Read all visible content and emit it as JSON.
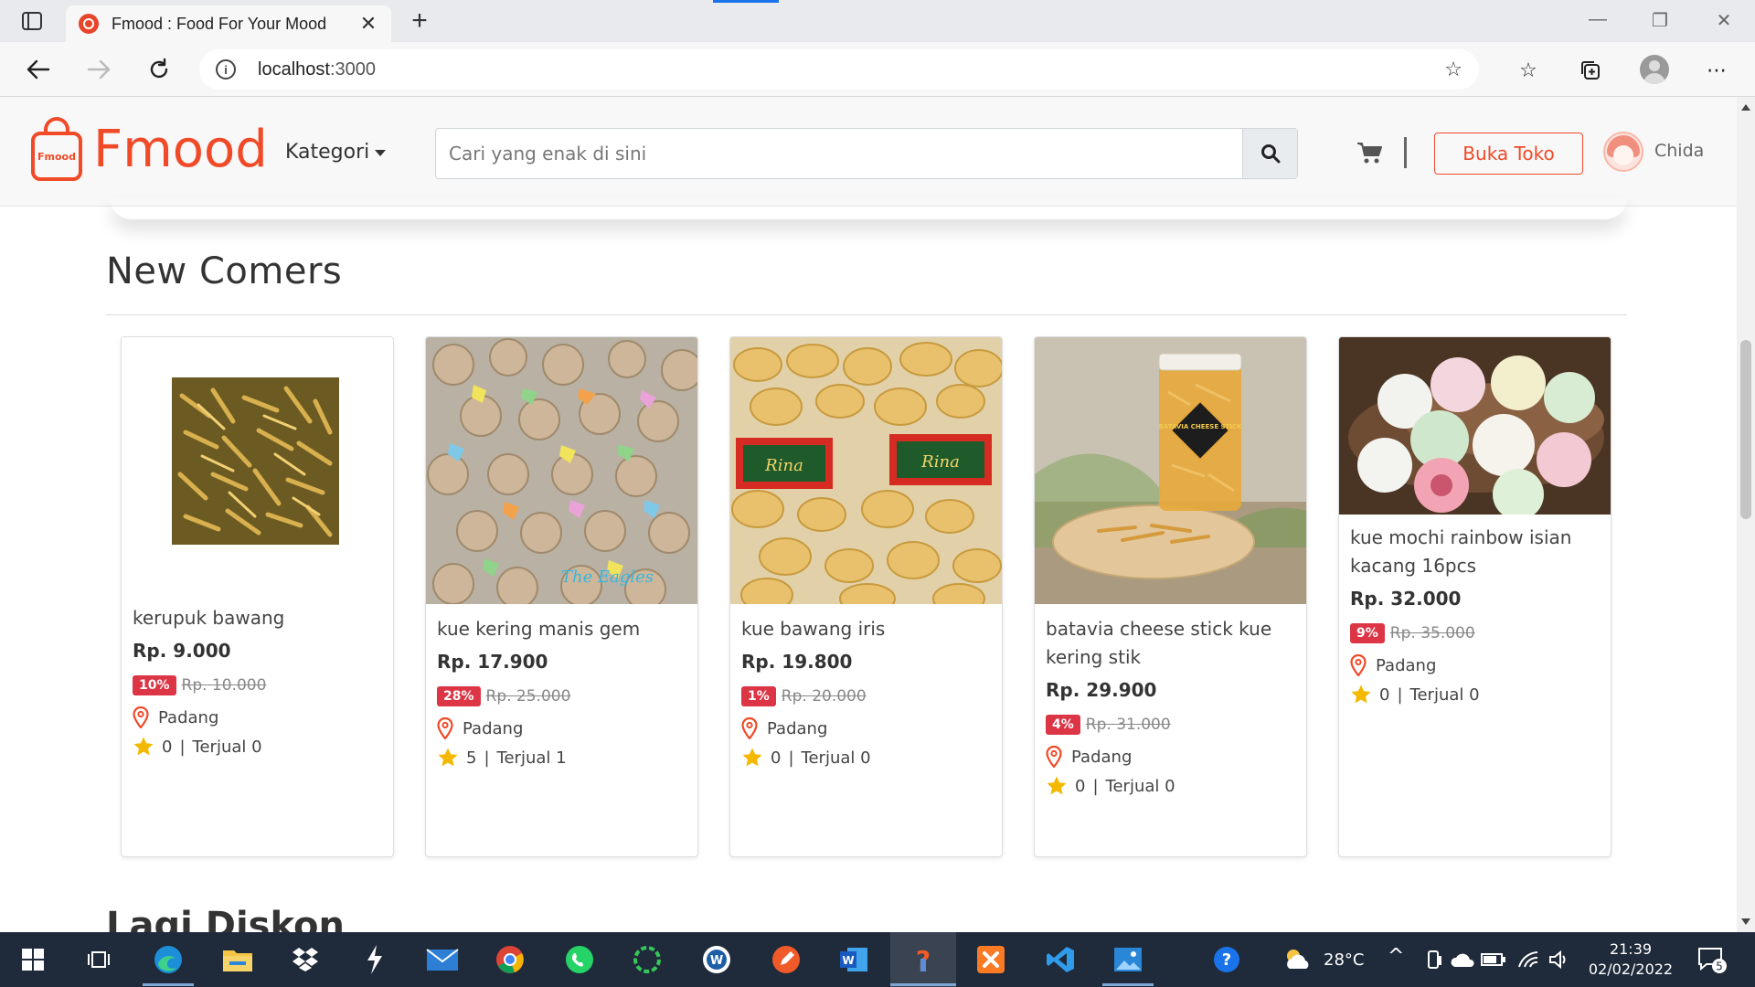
{
  "browser": {
    "tab_title": "Fmood : Food For Your Mood",
    "url_host": "localhost",
    "url_port": ":3000"
  },
  "header": {
    "logo_text": "Fmood",
    "logo_badge": "Fmood",
    "kategori_label": "Kategori",
    "search_placeholder": "Cari yang enak di sini",
    "open_store_label": "Buka Toko",
    "username": "Chida"
  },
  "sections": {
    "new_comers_title": "New Comers",
    "next_section_title": "Lagi Diskon"
  },
  "products": [
    {
      "name": "kerupuk bawang",
      "price": "Rp. 9.000",
      "discount": "10%",
      "old_price": "Rp. 10.000",
      "location": "Padang",
      "rating": "0",
      "sold": "Terjual 0"
    },
    {
      "name": "kue kering manis gem",
      "price": "Rp. 17.900",
      "discount": "28%",
      "old_price": "Rp. 25.000",
      "location": "Padang",
      "rating": "5",
      "sold": "Terjual 1",
      "image_text": "The Eagles"
    },
    {
      "name": "kue bawang iris",
      "price": "Rp. 19.800",
      "discount": "1%",
      "old_price": "Rp. 20.000",
      "location": "Padang",
      "rating": "0",
      "sold": "Terjual 0",
      "image_text": "Rina"
    },
    {
      "name": "batavia cheese stick kue kering stik",
      "price": "Rp. 29.900",
      "discount": "4%",
      "old_price": "Rp. 31.000",
      "location": "Padang",
      "rating": "0",
      "sold": "Terjual 0",
      "image_text": "BATAVIA CHEESE STICK"
    },
    {
      "name": "kue mochi rainbow isian kacang 16pcs",
      "price": "Rp. 32.000",
      "discount": "9%",
      "old_price": "Rp. 35.000",
      "location": "Padang",
      "rating": "0",
      "sold": "Terjual 0"
    }
  ],
  "taskbar": {
    "temperature": "28°C",
    "time": "21:39",
    "date": "02/02/2022",
    "notifications": "5"
  },
  "colors": {
    "brand": "#f04a28",
    "badge": "#dc3545",
    "star": "#f5b800",
    "taskbar": "#1f2a3a"
  }
}
